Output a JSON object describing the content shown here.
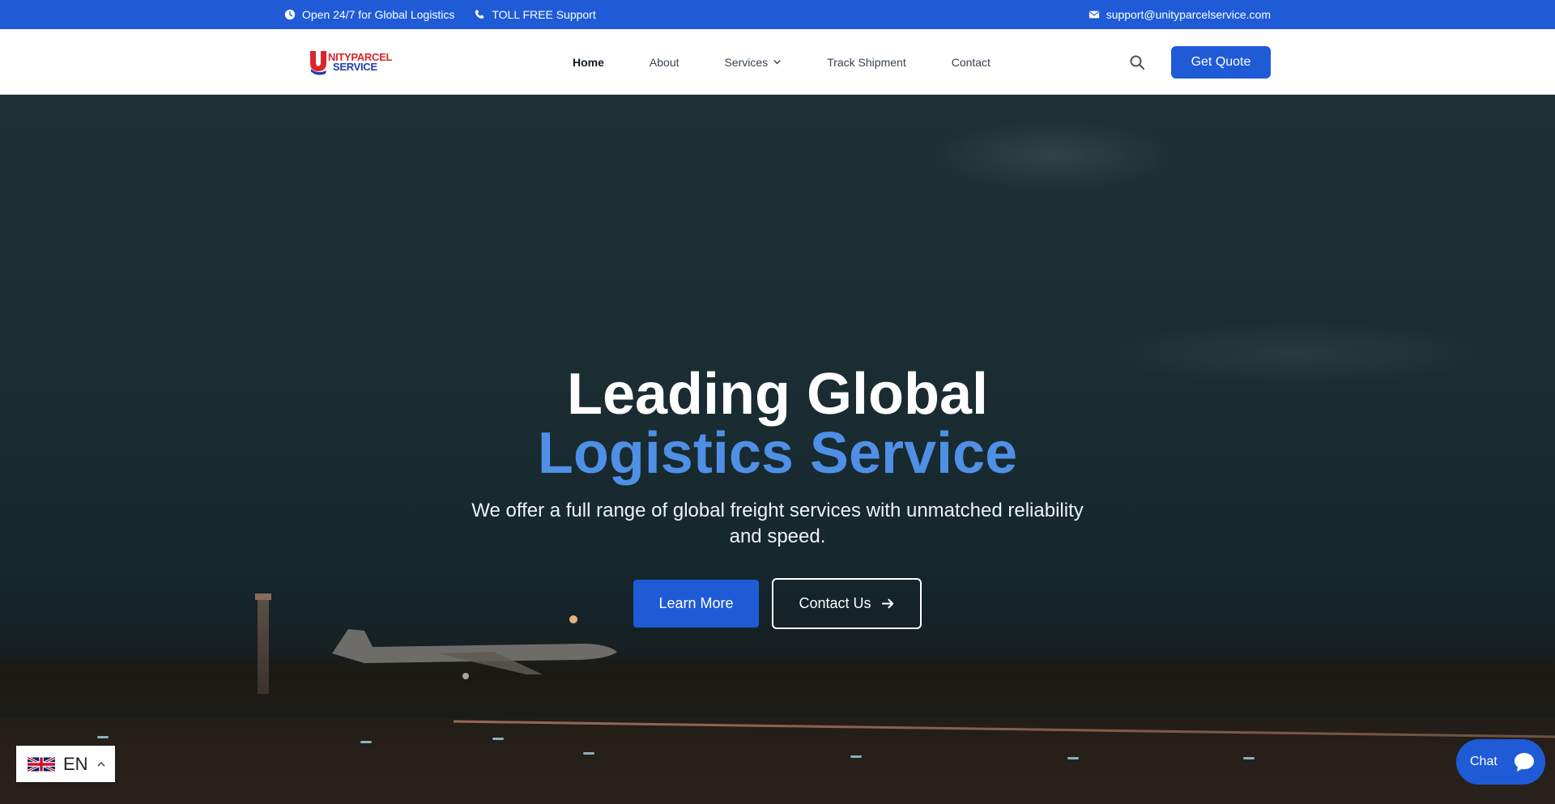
{
  "topbar": {
    "hours": "Open 24/7 for Global Logistics",
    "support": "TOLL FREE Support",
    "email": "support@unityparcelservice.com"
  },
  "header": {
    "logo_line1": "NITYPARCEL",
    "logo_line2": "SERVICE",
    "logo_letter": "U",
    "nav": {
      "home": "Home",
      "about": "About",
      "services": "Services",
      "track": "Track Shipment",
      "contact": "Contact"
    },
    "get_quote": "Get Quote"
  },
  "hero": {
    "title_line1": "Leading Global",
    "title_line2": "Logistics Service",
    "subtitle": "We offer a full range of global freight services with unmatched reliability and speed.",
    "learn_more": "Learn More",
    "contact_us": "Contact Us"
  },
  "language": {
    "code": "EN"
  },
  "chat": {
    "label": "Chat"
  },
  "colors": {
    "primary": "#1f5bd7",
    "accent": "#4f8fe6",
    "logo_red": "#d7262e",
    "logo_blue": "#1f3fae"
  }
}
